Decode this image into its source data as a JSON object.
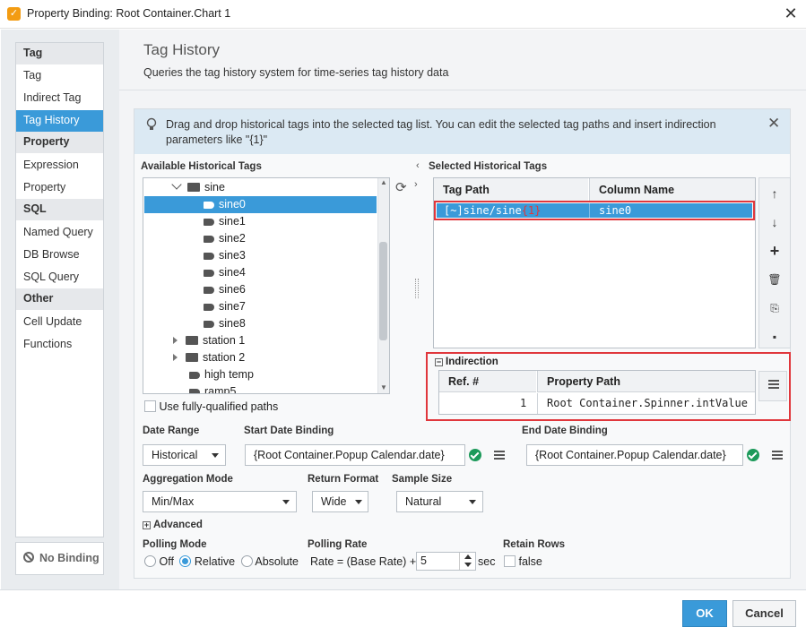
{
  "window": {
    "title": "Property Binding: Root Container.Chart 1"
  },
  "nav": {
    "sections": [
      {
        "label": "Tag",
        "items": [
          "Tag",
          "Indirect Tag",
          "Tag History"
        ]
      },
      {
        "label": "Property",
        "items": [
          "Expression",
          "Property"
        ]
      },
      {
        "label": "SQL",
        "items": [
          "Named Query",
          "DB Browse",
          "SQL Query"
        ]
      },
      {
        "label": "Other",
        "items": [
          "Cell Update",
          "Functions"
        ]
      }
    ],
    "active_item": "Tag History",
    "no_binding_label": "No Binding"
  },
  "main": {
    "title": "Tag History",
    "description": "Queries the tag history system for time-series tag history data",
    "info_text": "Drag and drop historical tags into the selected tag list. You can edit the selected tag paths and insert indirection parameters like \"{1}\""
  },
  "available": {
    "label": "Available Historical Tags",
    "folder": "sine",
    "tags": [
      "sine0",
      "sine1",
      "sine2",
      "sine3",
      "sine4",
      "sine6",
      "sine7",
      "sine8"
    ],
    "selected_tag": "sine0",
    "other_items": [
      "station 1",
      "station 2",
      "high temp",
      "ramp5"
    ],
    "fully_qualified_label": "Use fully-qualified paths"
  },
  "selected": {
    "label": "Selected Historical Tags",
    "columns": [
      "Tag Path",
      "Column Name"
    ],
    "rows": [
      {
        "tag_path_prefix": "[~]sine/sine",
        "tag_path_param": "{1}",
        "column_name": "sine0"
      }
    ]
  },
  "indirection": {
    "label": "Indirection",
    "columns": [
      "Ref. #",
      "Property Path"
    ],
    "rows": [
      {
        "ref": "1",
        "property_path": "Root Container.Spinner.intValue"
      }
    ]
  },
  "form": {
    "date_range_label": "Date Range",
    "date_range_value": "Historical",
    "start_binding_label": "Start Date Binding",
    "start_binding_value": "{Root Container.Popup Calendar.date}",
    "end_binding_label": "End Date Binding",
    "end_binding_value": "{Root Container.Popup Calendar.date}",
    "aggregation_label": "Aggregation Mode",
    "aggregation_value": "Min/Max",
    "return_format_label": "Return Format",
    "return_format_value": "Wide",
    "sample_size_label": "Sample Size",
    "sample_size_value": "Natural",
    "advanced_label": "Advanced",
    "polling_mode_label": "Polling Mode",
    "polling_options": [
      "Off",
      "Relative",
      "Absolute"
    ],
    "polling_selected": "Relative",
    "polling_rate_label": "Polling Rate",
    "polling_rate_prefix": "Rate = (Base Rate) +/-",
    "polling_rate_value": "5",
    "polling_rate_unit": "sec",
    "retain_rows_label": "Retain Rows",
    "retain_rows_value": "false"
  },
  "buttons": {
    "ok": "OK",
    "cancel": "Cancel"
  },
  "colors": {
    "accent": "#3a9ad9",
    "highlight": "#e0373c",
    "ok_button": "#3a9ad9"
  }
}
